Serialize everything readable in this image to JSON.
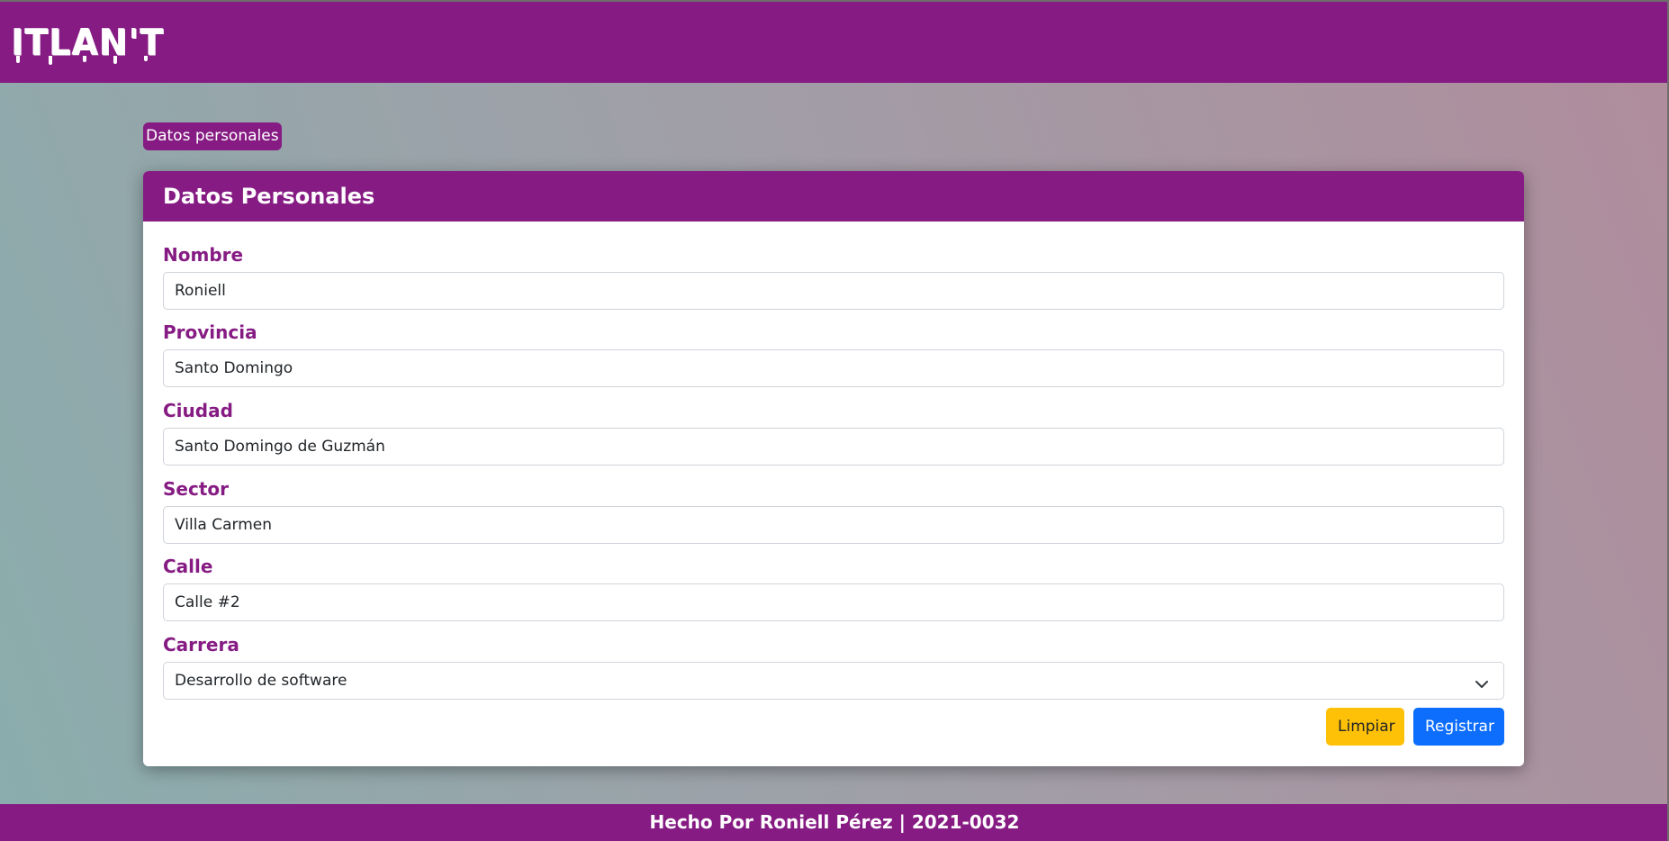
{
  "navbar": {
    "logo_text": "ITLAN'T"
  },
  "breadcrumb": {
    "label": "Datos personales"
  },
  "card": {
    "title": "Datos Personales",
    "fields": [
      {
        "label": "Nombre",
        "value": "Roniell"
      },
      {
        "label": "Provincia",
        "value": "Santo Domingo"
      },
      {
        "label": "Ciudad",
        "value": "Santo Domingo de Guzmán"
      },
      {
        "label": "Sector",
        "value": "Villa Carmen"
      },
      {
        "label": "Calle",
        "value": "Calle #2"
      }
    ],
    "career": {
      "label": "Carrera",
      "selected": "Desarrollo de software",
      "icon": "chevron-down-icon"
    },
    "buttons": {
      "clear_label": "Limpiar",
      "submit_label": "Registrar"
    }
  },
  "footer": {
    "text": "Hecho Por Roniell Pérez | 2021-0032"
  },
  "colors": {
    "brand": "#861c83",
    "warning": "#ffc107",
    "primary": "#0d6efd"
  }
}
